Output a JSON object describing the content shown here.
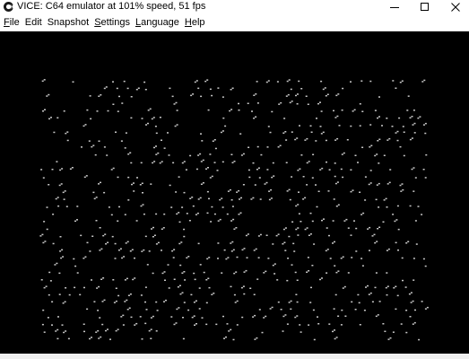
{
  "window": {
    "title": "VICE: C64 emulator at 101% speed, 51 fps"
  },
  "menu": {
    "items": [
      {
        "label": "File",
        "accel": "F",
        "rest": "ile"
      },
      {
        "label": "Edit",
        "accel": "",
        "rest": "Edit"
      },
      {
        "label": "Snapshot",
        "accel": "",
        "rest": "Snapshot"
      },
      {
        "label": "Settings",
        "accel": "S",
        "rest": "ettings"
      },
      {
        "label": "Language",
        "accel": "L",
        "rest": "anguage"
      },
      {
        "label": "Help",
        "accel": "H",
        "rest": "elp"
      }
    ]
  },
  "icons": {
    "app": "vice-logo-icon",
    "minimize": "minimize-icon",
    "maximize": "maximize-icon",
    "close": "close-icon"
  },
  "colors": {
    "screen_background": "#000000",
    "star": "#c8c8c8"
  }
}
